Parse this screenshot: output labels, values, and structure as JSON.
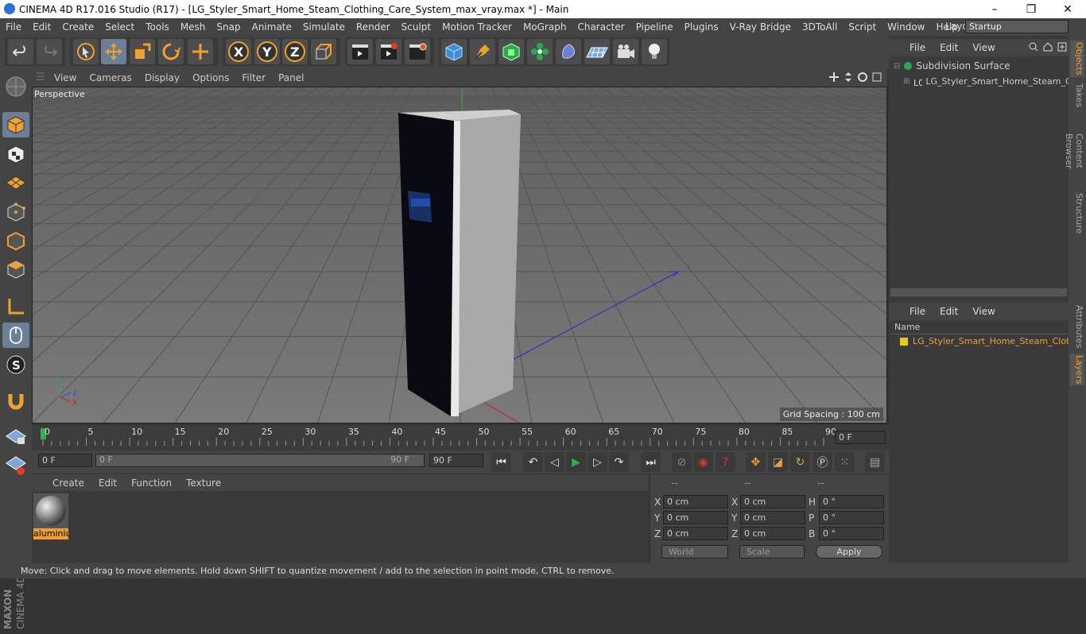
{
  "window": {
    "title": "CINEMA 4D R17.016 Studio (R17) - [LG_Styler_Smart_Home_Steam_Clothing_Care_System_max_vray.max *] - Main",
    "minimize": "–",
    "maximize": "❐",
    "close": "✕"
  },
  "menu": [
    "File",
    "Edit",
    "Create",
    "Select",
    "Tools",
    "Mesh",
    "Snap",
    "Animate",
    "Simulate",
    "Render",
    "Sculpt",
    "Motion Tracker",
    "MoGraph",
    "Character",
    "Pipeline",
    "Plugins",
    "V-Ray Bridge",
    "3DToAll",
    "Script",
    "Window",
    "Help"
  ],
  "layout": {
    "label": "Layout:",
    "value": "Startup"
  },
  "axis_buttons": [
    "X",
    "Y",
    "Z"
  ],
  "viewport": {
    "menu": [
      "View",
      "Cameras",
      "Display",
      "Options",
      "Filter",
      "Panel"
    ],
    "camera": "Perspective",
    "grid_spacing": "Grid Spacing : 100 cm",
    "axis_labels": [
      "Y",
      "Z",
      "X"
    ]
  },
  "timeline": {
    "ticks": [
      "0",
      "5",
      "10",
      "15",
      "20",
      "25",
      "30",
      "35",
      "40",
      "45",
      "50",
      "55",
      "60",
      "65",
      "70",
      "75",
      "80",
      "85",
      "90"
    ],
    "current_frame": "0 F",
    "start_field": "0 F",
    "range_start": "0 F",
    "range_end": "90 F",
    "end_field": "90 F"
  },
  "material_panel": {
    "menu": [
      "Create",
      "Edit",
      "Function",
      "Texture"
    ],
    "material_name": "aluminiu"
  },
  "coords": {
    "headers": [
      "--",
      "--",
      "--"
    ],
    "rows": [
      {
        "l1": "X",
        "v1": "0 cm",
        "l2": "X",
        "v2": "0 cm",
        "l3": "H",
        "v3": "0 °"
      },
      {
        "l1": "Y",
        "v1": "0 cm",
        "l2": "Y",
        "v2": "0 cm",
        "l3": "P",
        "v3": "0 °"
      },
      {
        "l1": "Z",
        "v1": "0 cm",
        "l2": "Z",
        "v2": "0 cm",
        "l3": "B",
        "v3": "0 °"
      }
    ],
    "world": "World",
    "scale": "Scale",
    "apply": "Apply"
  },
  "objects_panel": {
    "menu": [
      "File",
      "Edit",
      "View"
    ],
    "items": [
      "Subdivision Surface",
      "LG_Styler_Smart_Home_Steam_Clot"
    ]
  },
  "layers_panel": {
    "menu": [
      "File",
      "Edit",
      "View"
    ],
    "column": "Name",
    "items": [
      "LG_Styler_Smart_Home_Steam_Cloth"
    ]
  },
  "side_tabs": [
    "Objects",
    "Takes",
    "Content Browser",
    "Structure",
    "Attributes",
    "Layers"
  ],
  "status": "Move: Click and drag to move elements. Hold down SHIFT to quantize movement / add to the selection in point mode, CTRL to remove.",
  "brand": {
    "line1": "MAXON",
    "line2": "CINEMA 4D"
  },
  "colors": {
    "accent": "#f0a030",
    "selection": "#6b7f96",
    "viewport": "#6a6a6a"
  }
}
